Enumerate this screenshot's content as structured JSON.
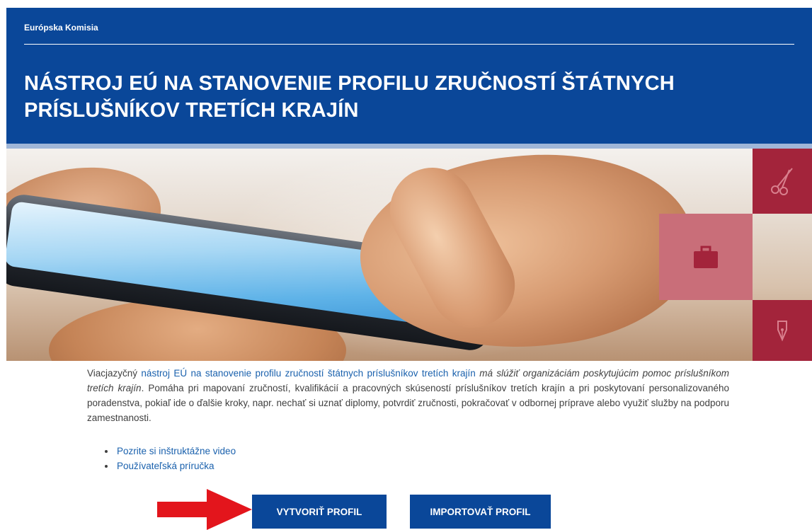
{
  "header": {
    "org_name": "Európska Komisia",
    "title_line1": "NÁSTROJ EÚ NA STANOVENIE PROFILU ZRUČNOSTÍ ŠTÁTNYCH",
    "title_line2": "PRÍSLUŠNÍKOV TRETÍCH KRAJÍN",
    "bg_color": "#0a4799"
  },
  "banner": {
    "tiles": [
      {
        "icon": "scissors-icon",
        "color": "#a3243b"
      },
      {
        "icon": "briefcase-icon",
        "color": "#c96e79"
      },
      {
        "icon": "pen-nib-icon",
        "color": "#a3243b"
      }
    ]
  },
  "intro": {
    "lead": "Viacjazyčný ",
    "tool_link": "nástroj EÚ na stanovenie profilu zručností štátnych príslušníkov tretích krajín",
    "purpose_italic": " má slúžiť organizáciám poskytujúcim pomoc príslušníkom tretích krajín",
    "body": ". Pomáha pri mapovaní zručností, kvalifikácií a pracovných skúseností príslušníkov tretích krajín a pri poskytovaní personalizovaného poradenstva, pokiaľ ide o ďalšie kroky, napr. nechať si uznať diplomy, potvrdiť zručnosti, pokračovať v odbornej príprave alebo využiť služby na podporu zamestnanosti."
  },
  "links": [
    {
      "label": "Pozrite si inštruktážne video"
    },
    {
      "label": "Používateľská príručka"
    }
  ],
  "actions": {
    "create_label": "VYTVORIŤ PROFIL",
    "import_label": "IMPORTOVAŤ PROFIL",
    "button_color": "#0a4799",
    "arrow_color": "#e3151c"
  }
}
